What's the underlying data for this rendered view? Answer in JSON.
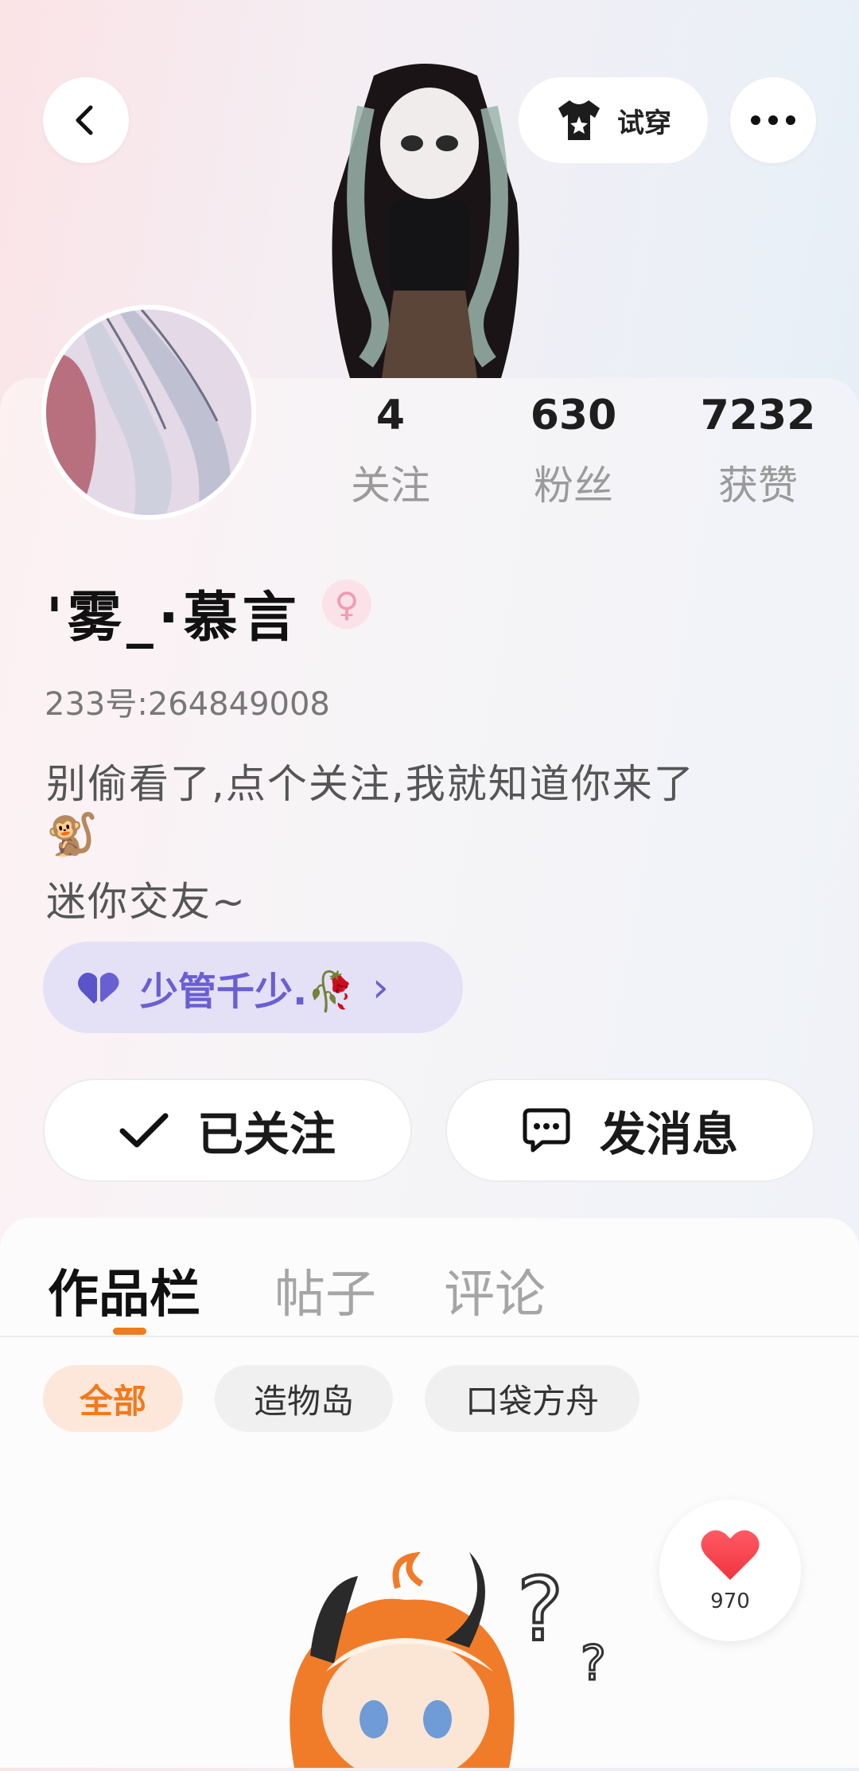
{
  "header": {
    "try_on_label": "试穿"
  },
  "profile": {
    "stats": [
      {
        "count": "4",
        "label": "关注"
      },
      {
        "count": "630",
        "label": "粉丝"
      },
      {
        "count": "7232",
        "label": "获赞"
      }
    ],
    "nickname": "'雾_·慕言",
    "gender_symbol": "♀",
    "id_text": "233号:264849008",
    "bio_line1": "别偷看了,点个关注,我就知道你来了",
    "bio_emoji": "🐒",
    "bio_line2": "迷你交友~",
    "relation_tag": "少管千少.🥀",
    "relation_tag_arrow": "›"
  },
  "actions": {
    "followed_label": "已关注",
    "message_label": "发消息"
  },
  "tabs": [
    {
      "label": "作品栏",
      "active": true
    },
    {
      "label": "帖子",
      "active": false
    },
    {
      "label": "评论",
      "active": false
    }
  ],
  "filters": [
    {
      "label": "全部",
      "active": true
    },
    {
      "label": "造物岛",
      "active": false
    },
    {
      "label": "口袋方舟",
      "active": false
    }
  ],
  "like_badge": {
    "count": "970"
  },
  "colors": {
    "accent": "#f07a1e",
    "tag_bg": "#e4e0f6",
    "tag_text": "#6a5fd1",
    "gender": "#f2a0b6"
  }
}
